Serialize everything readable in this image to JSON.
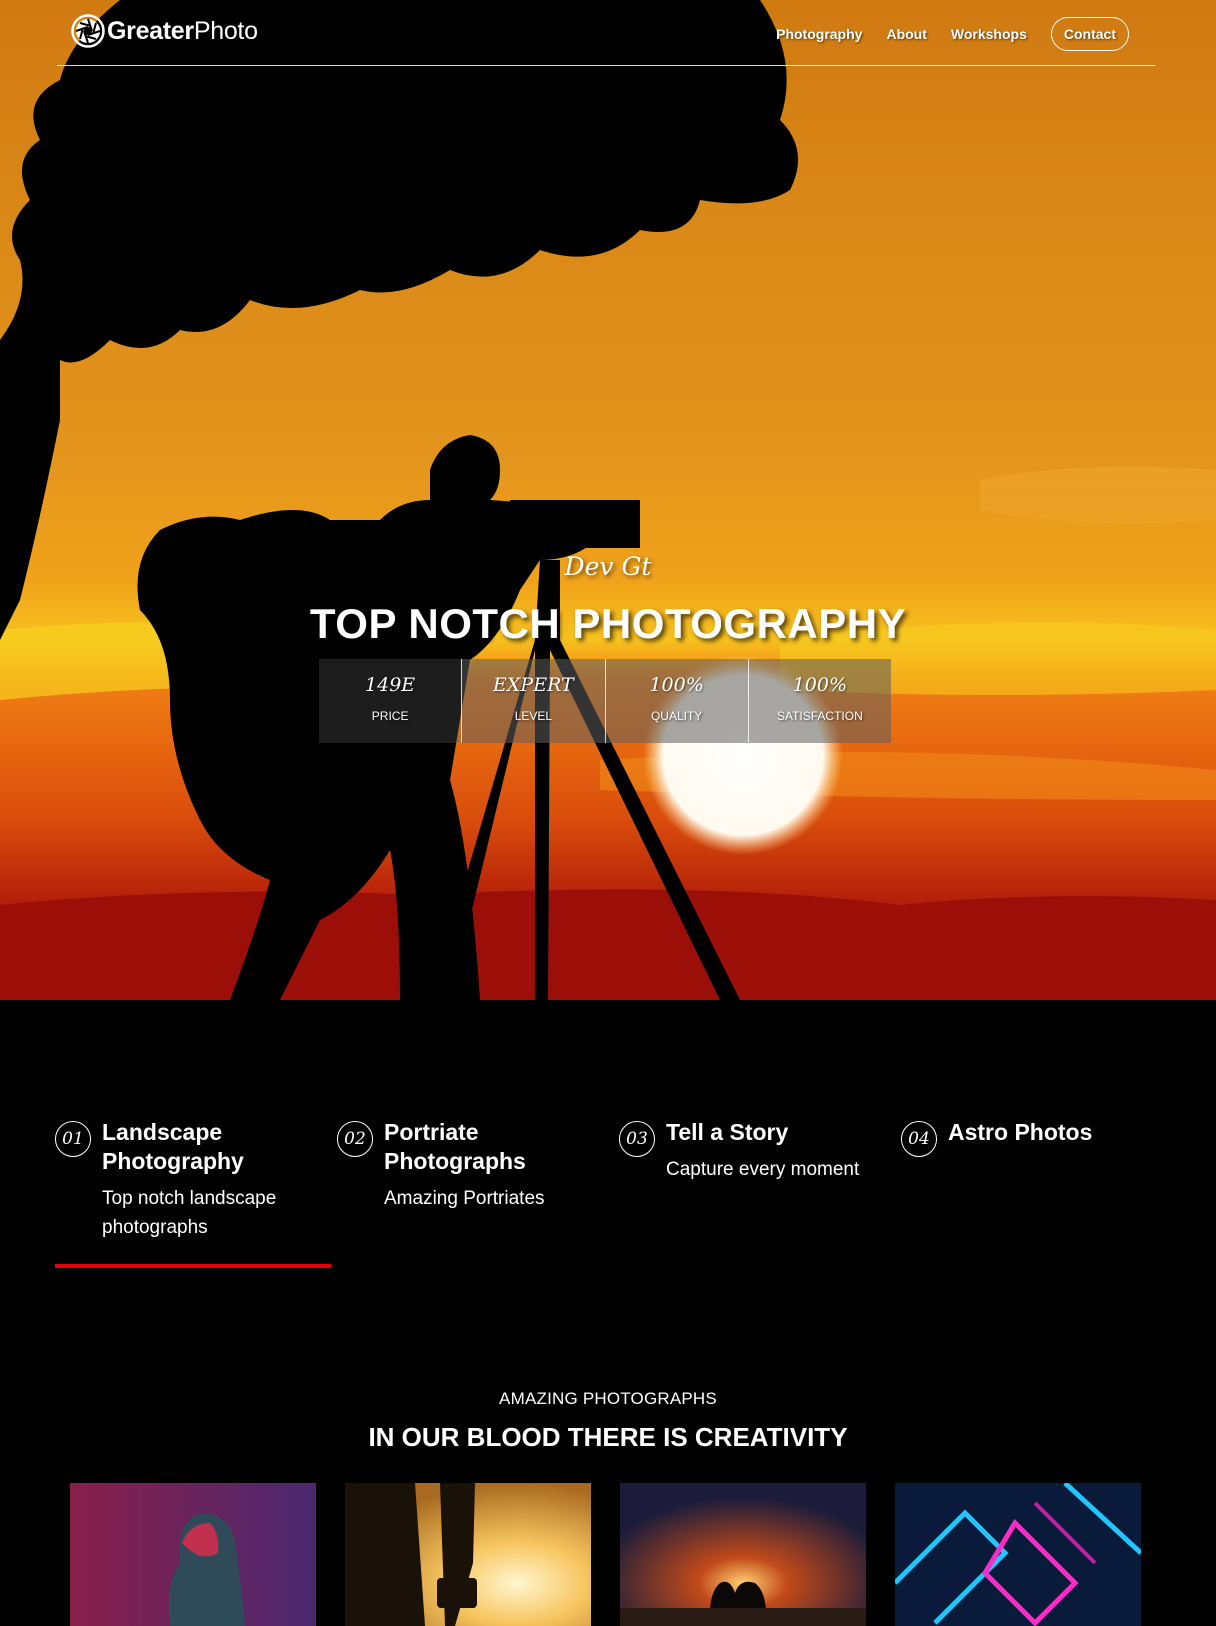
{
  "nav": {
    "logo_bold": "Greater",
    "logo_light": "Photo",
    "links": [
      "Photography",
      "About",
      "Workshops"
    ],
    "contact": "Contact"
  },
  "hero": {
    "subtitle": "Dev Gt",
    "title": "TOP NOTCH PHOTOGRAPHY",
    "stats": [
      {
        "value": "149E",
        "label": "PRICE"
      },
      {
        "value": "EXPERT",
        "label": "LEVEL"
      },
      {
        "value": "100%",
        "label": "QUALITY"
      },
      {
        "value": "100%",
        "label": "SATISFACTION"
      }
    ]
  },
  "features": [
    {
      "num": "01",
      "title": "Landscape Photography",
      "desc": "Top notch landscape photographs"
    },
    {
      "num": "02",
      "title": "Portriate Photographs",
      "desc": "Amazing Portriates"
    },
    {
      "num": "03",
      "title": "Tell a Story",
      "desc": "Capture every moment"
    },
    {
      "num": "04",
      "title": "Astro Photos",
      "desc": ""
    }
  ],
  "section": {
    "kicker": "AMAZING PHOTOGRAPHS",
    "title": "IN OUR BLOOD THERE IS CREATIVITY"
  },
  "colors": {
    "accent": "#e0000a",
    "background": "#000000"
  }
}
